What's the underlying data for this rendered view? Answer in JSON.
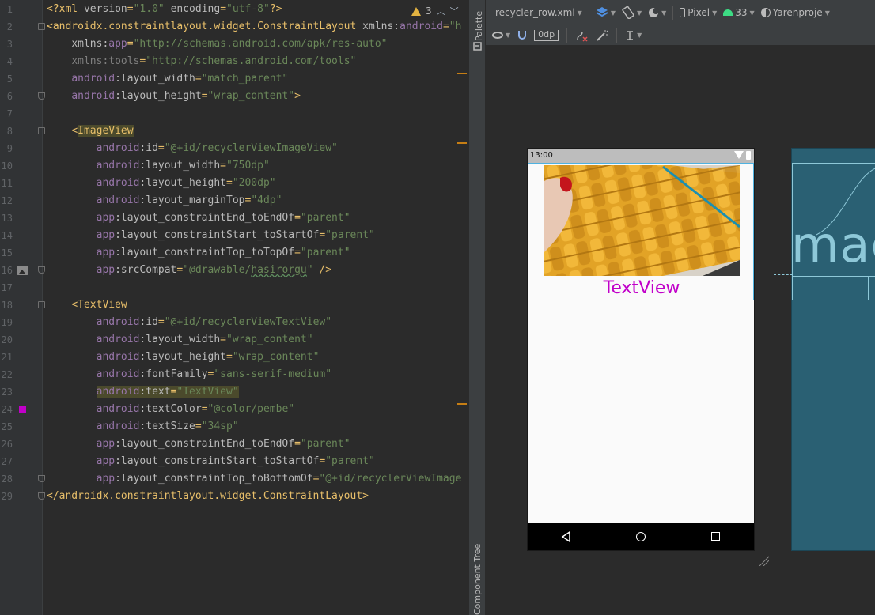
{
  "editor": {
    "warnings": {
      "count": "3"
    },
    "lines": [
      {
        "n": "1",
        "tokens": [
          [
            "decl",
            "<?xml "
          ],
          [
            "attr",
            "version"
          ],
          [
            "punct",
            "="
          ],
          [
            "val",
            "\"1.0\""
          ],
          [
            "attr",
            " encoding"
          ],
          [
            "punct",
            "="
          ],
          [
            "val",
            "\"utf-8\""
          ],
          [
            "decl",
            "?>"
          ]
        ]
      },
      {
        "n": "2",
        "tokens": [
          [
            "punct",
            "<"
          ],
          [
            "tag",
            "androidx.constraintlayout.widget.ConstraintLayout "
          ],
          [
            "attr",
            "xmlns:"
          ],
          [
            "ns",
            "android"
          ],
          [
            "punct",
            "="
          ],
          [
            "val",
            "\"h"
          ]
        ]
      },
      {
        "n": "3",
        "tokens": [
          [
            "attr",
            "    xmlns:"
          ],
          [
            "ns",
            "app"
          ],
          [
            "punct",
            "="
          ],
          [
            "val",
            "\"http://schemas.android.com/apk/res-auto\""
          ]
        ]
      },
      {
        "n": "4",
        "tokens": [
          [
            "dim",
            "    xmlns:tools"
          ],
          [
            "punct",
            "="
          ],
          [
            "val",
            "\"http://schemas.android.com/tools\""
          ]
        ]
      },
      {
        "n": "5",
        "tokens": [
          [
            "ns",
            "    android"
          ],
          [
            "attr",
            ":layout_width"
          ],
          [
            "punct",
            "="
          ],
          [
            "val",
            "\"match_parent\""
          ]
        ]
      },
      {
        "n": "6",
        "tokens": [
          [
            "ns",
            "    android"
          ],
          [
            "attr",
            ":layout_height"
          ],
          [
            "punct",
            "="
          ],
          [
            "val",
            "\"wrap_content\""
          ],
          [
            "punct",
            ">"
          ]
        ]
      },
      {
        "n": "7",
        "tokens": []
      },
      {
        "n": "8",
        "tokens": [
          [
            "punct",
            "    <"
          ],
          [
            "tag",
            "ImageView"
          ]
        ]
      },
      {
        "n": "9",
        "tokens": [
          [
            "ns",
            "        android"
          ],
          [
            "attr",
            ":id"
          ],
          [
            "punct",
            "="
          ],
          [
            "val",
            "\"@+id/recyclerViewImageView\""
          ]
        ]
      },
      {
        "n": "10",
        "tokens": [
          [
            "ns",
            "        android"
          ],
          [
            "attr",
            ":layout_width"
          ],
          [
            "punct",
            "="
          ],
          [
            "val",
            "\"750dp\""
          ]
        ]
      },
      {
        "n": "11",
        "tokens": [
          [
            "ns",
            "        android"
          ],
          [
            "attr",
            ":layout_height"
          ],
          [
            "punct",
            "="
          ],
          [
            "val",
            "\"200dp\""
          ]
        ]
      },
      {
        "n": "12",
        "tokens": [
          [
            "ns",
            "        android"
          ],
          [
            "attr",
            ":layout_marginTop"
          ],
          [
            "punct",
            "="
          ],
          [
            "val",
            "\"4dp\""
          ]
        ]
      },
      {
        "n": "13",
        "tokens": [
          [
            "ns",
            "        app"
          ],
          [
            "attr",
            ":layout_constraintEnd_toEndOf"
          ],
          [
            "punct",
            "="
          ],
          [
            "val",
            "\"parent\""
          ]
        ]
      },
      {
        "n": "14",
        "tokens": [
          [
            "ns",
            "        app"
          ],
          [
            "attr",
            ":layout_constraintStart_toStartOf"
          ],
          [
            "punct",
            "="
          ],
          [
            "val",
            "\"parent\""
          ]
        ]
      },
      {
        "n": "15",
        "tokens": [
          [
            "ns",
            "        app"
          ],
          [
            "attr",
            ":layout_constraintTop_toTopOf"
          ],
          [
            "punct",
            "="
          ],
          [
            "val",
            "\"parent\""
          ]
        ]
      },
      {
        "n": "16",
        "tokens": [
          [
            "ns",
            "        app"
          ],
          [
            "attr",
            ":srcCompat"
          ],
          [
            "punct",
            "="
          ],
          [
            "val",
            "\"@drawable/"
          ],
          [
            "valu",
            "hasirorgu"
          ],
          [
            "val",
            "\""
          ],
          [
            "punct",
            " />"
          ]
        ]
      },
      {
        "n": "17",
        "tokens": []
      },
      {
        "n": "18",
        "tokens": [
          [
            "punct",
            "    <"
          ],
          [
            "tag",
            "TextView"
          ]
        ]
      },
      {
        "n": "19",
        "tokens": [
          [
            "ns",
            "        android"
          ],
          [
            "attr",
            ":id"
          ],
          [
            "punct",
            "="
          ],
          [
            "val",
            "\"@+id/recyclerViewTextView\""
          ]
        ]
      },
      {
        "n": "20",
        "tokens": [
          [
            "ns",
            "        android"
          ],
          [
            "attr",
            ":layout_width"
          ],
          [
            "punct",
            "="
          ],
          [
            "val",
            "\"wrap_content\""
          ]
        ]
      },
      {
        "n": "21",
        "tokens": [
          [
            "ns",
            "        android"
          ],
          [
            "attr",
            ":layout_height"
          ],
          [
            "punct",
            "="
          ],
          [
            "val",
            "\"wrap_content\""
          ]
        ]
      },
      {
        "n": "22",
        "tokens": [
          [
            "ns",
            "        android"
          ],
          [
            "attr",
            ":fontFamily"
          ],
          [
            "punct",
            "="
          ],
          [
            "val",
            "\"sans-serif-medium\""
          ]
        ]
      },
      {
        "n": "23",
        "tokens": [
          [
            "ns",
            "        android"
          ],
          [
            "attr",
            ":text"
          ],
          [
            "punct",
            "="
          ],
          [
            "val",
            "\"TextView\""
          ]
        ]
      },
      {
        "n": "24",
        "tokens": [
          [
            "ns",
            "        android"
          ],
          [
            "attr",
            ":textColor"
          ],
          [
            "punct",
            "="
          ],
          [
            "val",
            "\"@color/pembe\""
          ]
        ]
      },
      {
        "n": "25",
        "tokens": [
          [
            "ns",
            "        android"
          ],
          [
            "attr",
            ":textSize"
          ],
          [
            "punct",
            "="
          ],
          [
            "val",
            "\"34sp\""
          ]
        ]
      },
      {
        "n": "26",
        "tokens": [
          [
            "ns",
            "        app"
          ],
          [
            "attr",
            ":layout_constraintEnd_toEndOf"
          ],
          [
            "punct",
            "="
          ],
          [
            "val",
            "\"parent\""
          ]
        ]
      },
      {
        "n": "27",
        "tokens": [
          [
            "ns",
            "        app"
          ],
          [
            "attr",
            ":layout_constraintStart_toStartOf"
          ],
          [
            "punct",
            "="
          ],
          [
            "val",
            "\"parent\""
          ]
        ]
      },
      {
        "n": "28",
        "tokens": [
          [
            "ns",
            "        app"
          ],
          [
            "attr",
            ":layout_constraintTop_toBottomOf"
          ],
          [
            "punct",
            "="
          ],
          [
            "val",
            "\"@+id/recyclerViewImage"
          ]
        ]
      },
      {
        "n": "29",
        "tokens": [
          [
            "punct",
            "</"
          ],
          [
            "tag",
            "androidx.constraintlayout.widget.ConstraintLayout"
          ],
          [
            "punct",
            ">"
          ]
        ]
      }
    ]
  },
  "side_strip": {
    "palette_label": "Palette",
    "component_tree_label": "Component Tree"
  },
  "toolbar": {
    "file": "recycler_row.xml",
    "device": "Pixel",
    "api": "33",
    "theme": "Yarenproje",
    "margin": "0dp"
  },
  "device_preview": {
    "time": "13:00",
    "text_view": "TextView",
    "text_color": "#c100c9"
  },
  "blueprint": {
    "image_text": "mag"
  },
  "colors": {
    "accent_warning": "#e3b341",
    "selection": "#4fb2e0",
    "blueprint_bg": "#2a6073"
  }
}
